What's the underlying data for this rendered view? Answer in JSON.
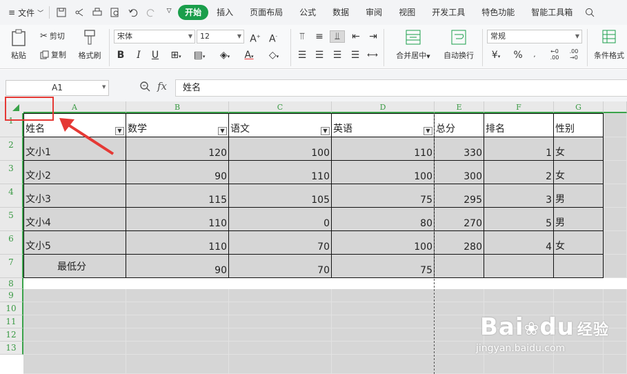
{
  "menubar": {
    "file_label": "文件",
    "tabs": [
      "开始",
      "插入",
      "页面布局",
      "公式",
      "数据",
      "审阅",
      "视图",
      "开发工具",
      "特色功能",
      "智能工具箱"
    ]
  },
  "ribbon": {
    "paste": "粘贴",
    "cut": "剪切",
    "copy": "复制",
    "format_painter": "格式刷",
    "font_name": "宋体",
    "font_size": "12",
    "merge_center": "合并居中",
    "wrap_text": "自动换行",
    "number_format": "常规",
    "conditional_format": "条件格式"
  },
  "formula_bar": {
    "name_box": "A1",
    "fx": "fx",
    "content": "姓名"
  },
  "columns": [
    "A",
    "B",
    "C",
    "D",
    "E",
    "F",
    "G"
  ],
  "rows": [
    "1",
    "2",
    "3",
    "4",
    "5",
    "6",
    "7",
    "8",
    "9",
    "10",
    "11",
    "12",
    "13"
  ],
  "table": {
    "headers": [
      "姓名",
      "数学",
      "语文",
      "英语",
      "总分",
      "排名",
      "性别"
    ],
    "data": [
      [
        "文小1",
        "120",
        "100",
        "110",
        "330",
        "1",
        "女"
      ],
      [
        "文小2",
        "90",
        "110",
        "100",
        "300",
        "2",
        "女"
      ],
      [
        "文小3",
        "115",
        "105",
        "75",
        "295",
        "3",
        "男"
      ],
      [
        "文小4",
        "110",
        "0",
        "80",
        "270",
        "5",
        "男"
      ],
      [
        "文小5",
        "110",
        "70",
        "100",
        "280",
        "4",
        "女"
      ],
      [
        "最低分",
        "90",
        "70",
        "75",
        "",
        "",
        ""
      ]
    ]
  },
  "watermark": {
    "brand": "Bai",
    "brand2": "du",
    "site_cn": "经验",
    "url": "jingyan.baidu.com"
  },
  "colors": {
    "accent": "#1a9e4b",
    "header_green": "#3aa34a",
    "highlight_red": "#e53935"
  }
}
